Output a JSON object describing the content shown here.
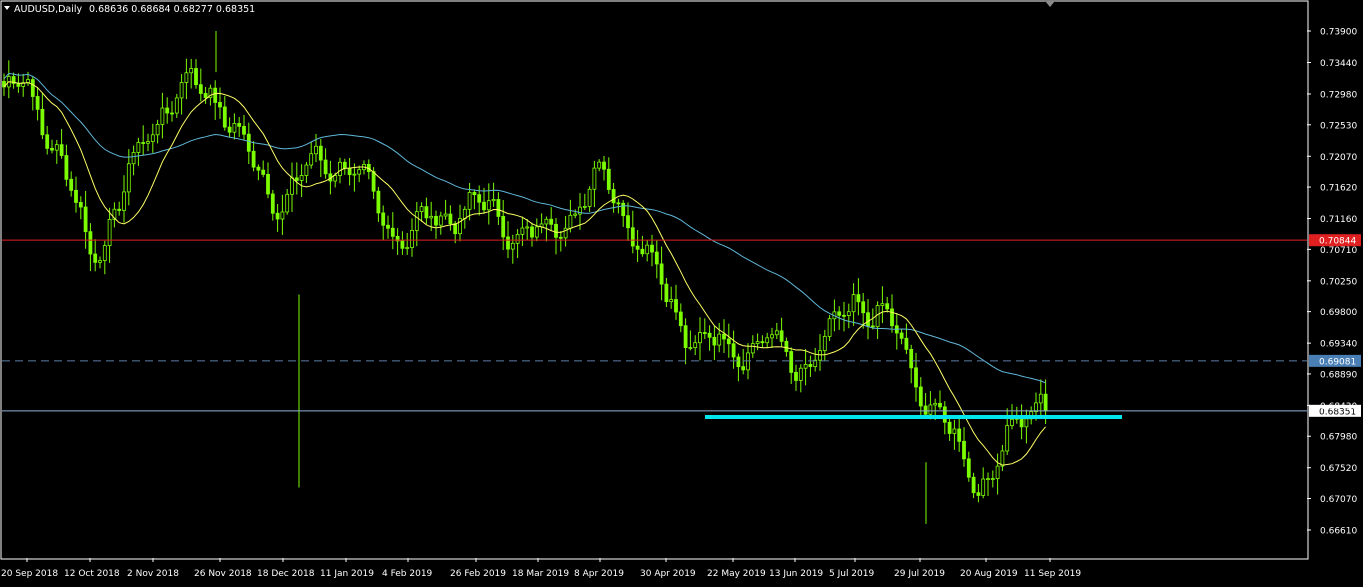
{
  "header": {
    "symbol_timeframe": "AUDUSD,Daily",
    "ohlc": "0.68636 0.68684 0.68277 0.68351"
  },
  "colors": {
    "background": "#000000",
    "candle": "#7CFC00",
    "ma_fast": "#FFFF66",
    "ma_slow": "#5FB7D9",
    "price_line": "#8FB3D9",
    "resistance_line": "#E02020",
    "dashed_level": "#5B7FA6",
    "support_trendline": "#00E5EE",
    "axis": "#FFFFFF",
    "label_red_bg": "#E02020",
    "label_blue_bg": "#4A7FB5"
  },
  "chart_data": {
    "type": "candlestick",
    "x_labels": [
      "20 Sep 2018",
      "12 Oct 2018",
      "2 Nov 2018",
      "26 Nov 2018",
      "18 Dec 2018",
      "11 Jan 2019",
      "4 Feb 2019",
      "26 Feb 2019",
      "18 Mar 2019",
      "8 Apr 2019",
      "30 Apr 2019",
      "22 May 2019",
      "13 Jun 2019",
      "5 Jul 2019",
      "29 Jul 2019",
      "20 Aug 2019",
      "11 Sep 2019"
    ],
    "y_ticks": [
      "0.73900",
      "0.73440",
      "0.72980",
      "0.72530",
      "0.72070",
      "0.71620",
      "0.71160",
      "0.70710",
      "0.70250",
      "0.69800",
      "0.69340",
      "0.68890",
      "0.68430",
      "0.67980",
      "0.67520",
      "0.67070",
      "0.66610"
    ],
    "ylim": [
      0.6661,
      0.739
    ],
    "levels": {
      "resistance": {
        "value": 0.70844,
        "label": "0.70844"
      },
      "dashed": {
        "value": 0.69081,
        "label": "0.69081"
      },
      "current": {
        "value": 0.68351,
        "label": "0.68351"
      }
    },
    "support_trendline": {
      "from": "22 May 2019",
      "to": "11 Sep 2019",
      "value": 0.6826
    },
    "close_path": [
      [
        "20 Sep 2018",
        0.7285
      ],
      [
        "12 Oct 2018",
        0.709
      ],
      [
        "2 Nov 2018",
        0.725
      ],
      [
        "26 Nov 2018",
        0.73
      ],
      [
        "18 Dec 2018",
        0.715
      ],
      [
        "11 Jan 2019",
        0.718
      ],
      [
        "4 Feb 2019",
        0.712
      ],
      [
        "26 Feb 2019",
        0.71
      ],
      [
        "18 Mar 2019",
        0.712
      ],
      [
        "8 Apr 2019",
        0.715
      ],
      [
        "30 Apr 2019",
        0.702
      ],
      [
        "22 May 2019",
        0.691
      ],
      [
        "13 Jun 2019",
        0.69
      ],
      [
        "5 Jul 2019",
        0.702
      ],
      [
        "29 Jul 2019",
        0.685
      ],
      [
        "20 Aug 2019",
        0.676
      ],
      [
        "11 Sep 2019",
        0.685
      ]
    ]
  }
}
